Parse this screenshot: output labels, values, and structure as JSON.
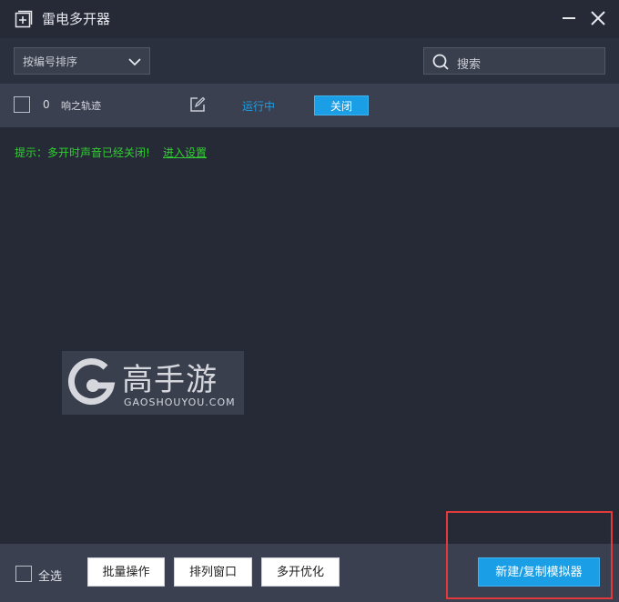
{
  "app": {
    "title": "雷电多开器",
    "icons": {
      "app": "plus-square-icon",
      "minimize": "minimize-icon",
      "close": "close-icon"
    }
  },
  "toolbar": {
    "sort_selected": "按编号排序",
    "search_placeholder": "搜索"
  },
  "instances": [
    {
      "index": "0",
      "name": "响之轨迹",
      "status": "运行中",
      "action": "关闭"
    }
  ],
  "tip": {
    "text": "提示：多开时声音已经关闭!",
    "link": "进入设置"
  },
  "watermark": {
    "cn": "高手游",
    "en": "GAOSHOUYOU.COM"
  },
  "footer": {
    "select_all": "全选",
    "batch": "批量操作",
    "arrange": "排列窗口",
    "optimize": "多开优化",
    "new_copy": "新建/复制模拟器"
  },
  "colors": {
    "accent": "#1a9ee6",
    "tip": "#2fd02f",
    "highlight": "#e23a3a",
    "background": "#262a37"
  }
}
